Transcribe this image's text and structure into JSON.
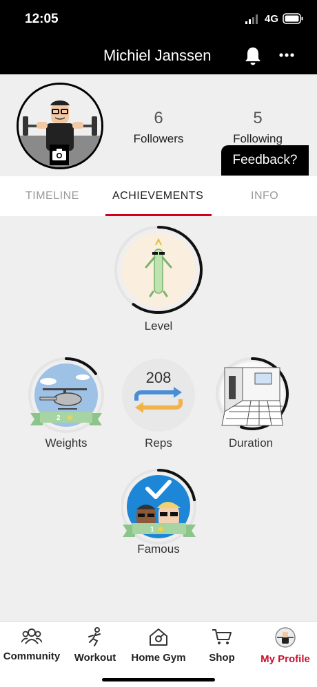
{
  "status_bar": {
    "time": "12:05",
    "network": "4G"
  },
  "header": {
    "title": "Michiel Janssen",
    "icons": [
      "bell-icon",
      "more-icon"
    ]
  },
  "profile": {
    "followers": {
      "count": "6",
      "label": "Followers"
    },
    "following": {
      "count": "5",
      "label": "Following"
    },
    "feedback_label": "Feedback?"
  },
  "tabs": [
    {
      "label": "TIMELINE",
      "active": false
    },
    {
      "label": "ACHIEVEMENTS",
      "active": true
    },
    {
      "label": "INFO",
      "active": false
    }
  ],
  "achievements": {
    "level": {
      "label": "Level",
      "progress": 0.6
    },
    "weights": {
      "label": "Weights",
      "badge_level": "2",
      "progress": 0.15
    },
    "reps": {
      "label": "Reps",
      "count": "208"
    },
    "duration": {
      "label": "Duration",
      "progress": 0.55
    },
    "famous": {
      "label": "Famous",
      "badge_level": "1",
      "progress": 0.22
    }
  },
  "bottom_nav": [
    {
      "label": "Community",
      "icon": "community-icon",
      "active": false
    },
    {
      "label": "Workout",
      "icon": "workout-icon",
      "active": false
    },
    {
      "label": "Home Gym",
      "icon": "home-gym-icon",
      "active": false
    },
    {
      "label": "Shop",
      "icon": "cart-icon",
      "active": false
    },
    {
      "label": "My Profile",
      "icon": "profile-avatar-icon",
      "active": true
    }
  ],
  "colors": {
    "accent_red": "#d0021b",
    "header_bg": "#000000"
  }
}
